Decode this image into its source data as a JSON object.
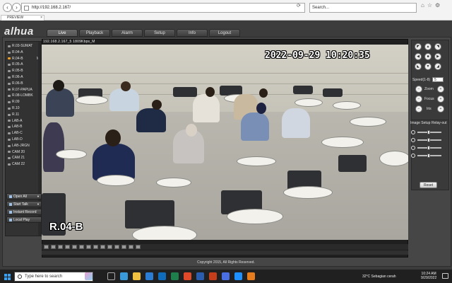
{
  "browser": {
    "url": "http://192.168.2.167/",
    "search_placeholder": "Search...",
    "tab_title": "PREVIEW"
  },
  "app": {
    "logo": "alhua",
    "nav": [
      "Live",
      "Playback",
      "Alarm",
      "Setup",
      "Info",
      "Logout"
    ],
    "active_nav": "Live"
  },
  "sidebar": {
    "channels": [
      {
        "label": "R.03-SUMAT",
        "mark": ""
      },
      {
        "label": "R.04-A",
        "mark": ""
      },
      {
        "label": "R.04-B",
        "mark": "M"
      },
      {
        "label": "R.05-A",
        "mark": ""
      },
      {
        "label": "R.05-B",
        "mark": ""
      },
      {
        "label": "R.06-A",
        "mark": ""
      },
      {
        "label": "R.06-B",
        "mark": ""
      },
      {
        "label": "R.07-PAPUA",
        "mark": ""
      },
      {
        "label": "R.08-LOMBK",
        "mark": ""
      },
      {
        "label": "R.09",
        "mark": ""
      },
      {
        "label": "R.10",
        "mark": ""
      },
      {
        "label": "R.11",
        "mark": ""
      },
      {
        "label": "LAB-A",
        "mark": ""
      },
      {
        "label": "LAB-B",
        "mark": ""
      },
      {
        "label": "LAB-C",
        "mark": ""
      },
      {
        "label": "LAB-D",
        "mark": ""
      },
      {
        "label": "LAB-JRGN",
        "mark": ""
      },
      {
        "label": "CAM 20",
        "mark": ""
      },
      {
        "label": "CAM 21",
        "mark": ""
      },
      {
        "label": "CAM 22",
        "mark": ""
      }
    ],
    "selected_index": 2,
    "buttons": [
      "Open All",
      "Start Talk",
      "Instant Record",
      "Local Play"
    ]
  },
  "video": {
    "info": "192.168.2.167_5 1809Kbps_M",
    "timestamp": "2022-09-29 10:20:35",
    "camera_label": "R.04-B"
  },
  "ptz": {
    "speed_label": "Speed(1-8)",
    "speed_value": "5",
    "zoom_label": "Zoom",
    "focus_label": "Focus",
    "iris_label": "Iris",
    "minus": "−",
    "plus": "+"
  },
  "image_setup": {
    "title": "Image Setup",
    "relay_label": "Relay-out",
    "reset_label": "Reset"
  },
  "footer": {
    "copyright": "Copyright 2015, All Rights Reserved."
  },
  "taskbar": {
    "search_placeholder": "Type here to search",
    "weather": "32°C  Sebagian cerah",
    "time": "10:24 AM",
    "date": "9/29/2022"
  }
}
